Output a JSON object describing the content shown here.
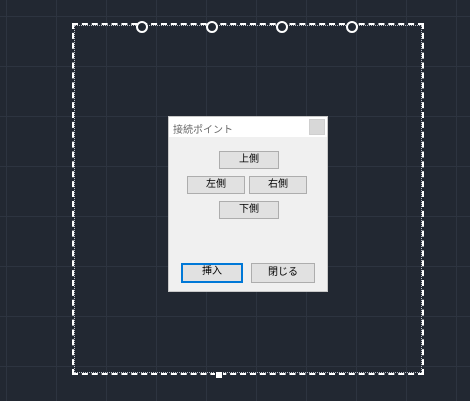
{
  "dialog": {
    "title": "接続ポイント",
    "buttons": {
      "top": "上側",
      "left": "左側",
      "right": "右側",
      "bottom": "下側",
      "insert": "挿入",
      "close": "閉じる"
    }
  },
  "colors": {
    "canvas_bg": "#222832",
    "grid_line": "#2d3440",
    "frame": "#ffffff",
    "dialog_bg": "#f0f0f0",
    "button_bg": "#e1e1e1",
    "default_button_border": "#0078d7"
  }
}
